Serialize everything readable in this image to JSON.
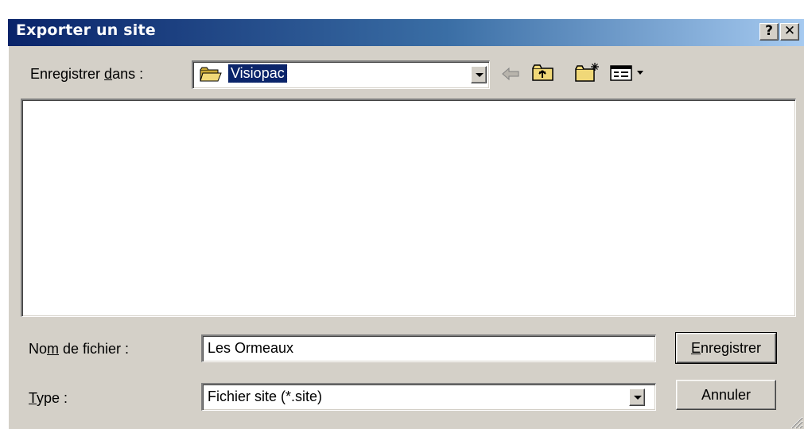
{
  "window": {
    "title": "Exporter un site",
    "help_label": "?",
    "close_label": "✕"
  },
  "location": {
    "label_prefix": "Enregistrer ",
    "label_accel": "d",
    "label_suffix": "ans :",
    "current_folder": "Visiopac"
  },
  "toolbar": {
    "back_icon": "back-arrow-icon",
    "up_icon": "up-folder-icon",
    "new_folder_icon": "new-folder-icon",
    "views_icon": "view-menu-icon"
  },
  "filename": {
    "label_prefix": "No",
    "label_accel": "m",
    "label_suffix": " de fichier :",
    "value": "Les Ormeaux"
  },
  "type": {
    "label_accel": "T",
    "label_suffix": "ype :",
    "value": "Fichier site (*.site)"
  },
  "buttons": {
    "save_accel": "E",
    "save_suffix": "nregistrer",
    "cancel": "Annuler"
  },
  "colors": {
    "title_start": "#0a246a",
    "title_end": "#a6caf0",
    "face": "#d4d0c8",
    "selection": "#0a246a"
  }
}
